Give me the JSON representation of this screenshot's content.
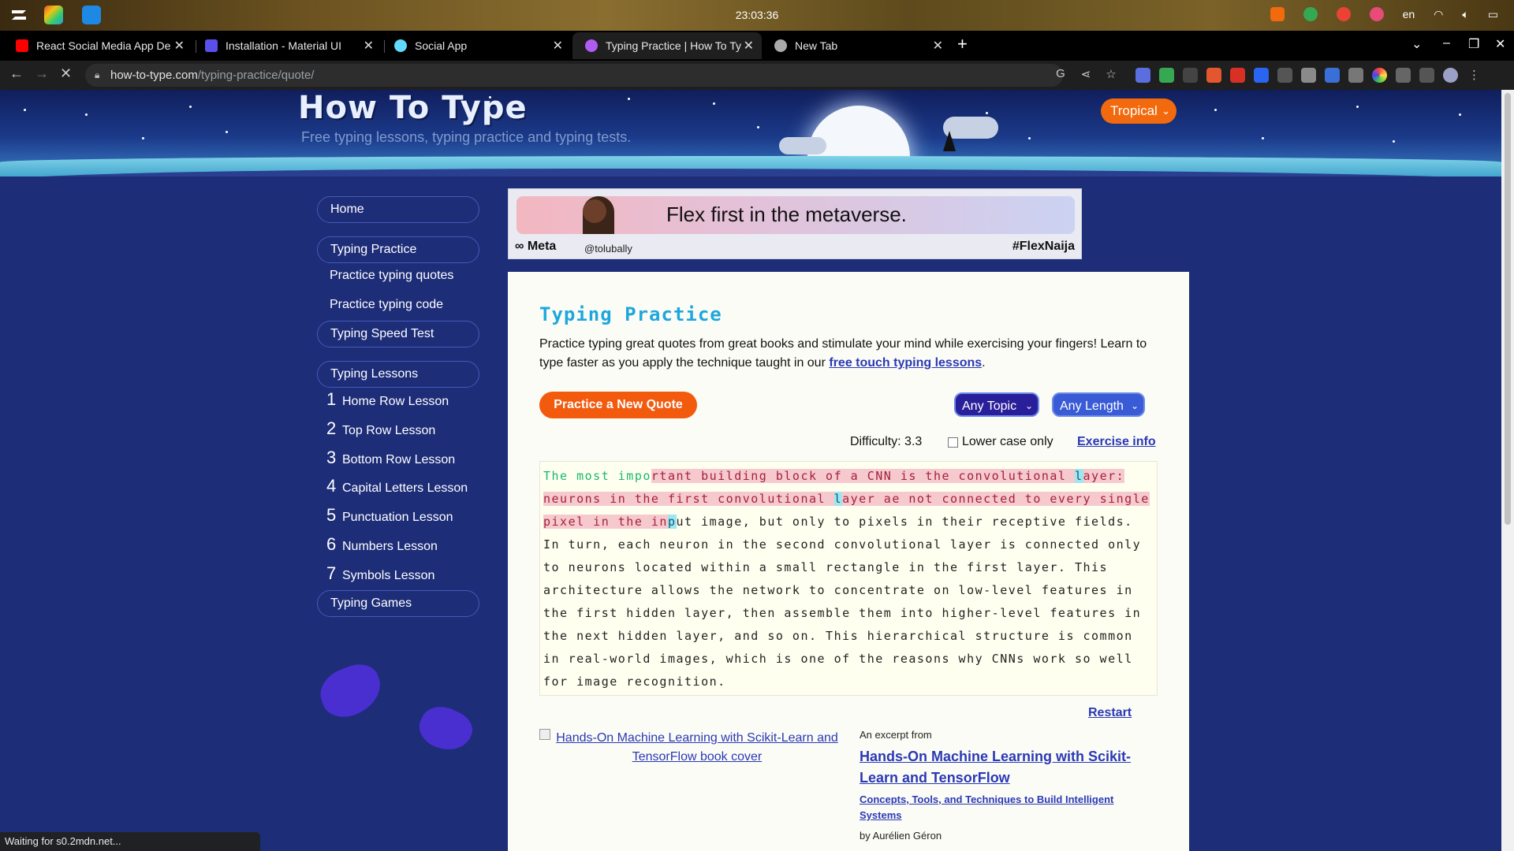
{
  "os": {
    "clock": "23:03:36",
    "lang": "en",
    "icons": [
      "zorin-logo-icon",
      "apps-grid-icon",
      "finder-icon"
    ]
  },
  "browser": {
    "tabs": [
      {
        "title": "React Social Media App Des",
        "favicon": "youtube-icon",
        "color": "#ff0000"
      },
      {
        "title": "Installation - Material UI",
        "favicon": "mui-icon",
        "color": "#5a4fe8"
      },
      {
        "title": "Social App",
        "favicon": "react-icon",
        "color": "#61dafb"
      },
      {
        "title": "Typing Practice | How To Ty",
        "favicon": "howtotype-icon",
        "color": "#b15cf0"
      },
      {
        "title": "New Tab",
        "favicon": "chrome-icon",
        "color": "#aaaaaa"
      }
    ],
    "url_host": "how-to-type.com",
    "url_path": "/typing-practice/quote/",
    "status_text": "Waiting for s0.2mdn.net..."
  },
  "site": {
    "title": "How To Type",
    "tagline": "Free typing lessons, typing practice and typing tests.",
    "theme": "Tropical"
  },
  "sidebar": {
    "home": "Home",
    "typing_practice": "Typing Practice",
    "practice_quotes": "Practice typing quotes",
    "practice_code": "Practice typing code",
    "speed_test": "Typing Speed Test",
    "lessons_header": "Typing Lessons",
    "lessons": [
      {
        "num": "1",
        "label": "Home Row Lesson"
      },
      {
        "num": "2",
        "label": "Top Row Lesson"
      },
      {
        "num": "3",
        "label": "Bottom Row Lesson"
      },
      {
        "num": "4",
        "label": "Capital Letters Lesson"
      },
      {
        "num": "5",
        "label": "Punctuation Lesson"
      },
      {
        "num": "6",
        "label": "Numbers Lesson"
      },
      {
        "num": "7",
        "label": "Symbols Lesson"
      }
    ],
    "games": "Typing Games"
  },
  "ad": {
    "headline": "Flex first in the metaverse.",
    "brand": "∞ Meta",
    "handle": "@tolubally",
    "hashtag": "#FlexNaija"
  },
  "main": {
    "heading": "Typing Practice",
    "intro_text": "Practice typing great quotes from great books and stimulate your mind while exercising your fingers! Learn to type faster as you apply the technique taught in our ",
    "intro_link": "free touch typing lessons",
    "intro_end": ".",
    "new_quote_button": "Practice a New Quote",
    "topic_select": "Any Topic",
    "length_select": "Any Length",
    "difficulty": "Difficulty: 3.3",
    "lowercase_label": "Lower case only",
    "exercise_info": "Exercise info",
    "quote": {
      "correct": "The most impo",
      "wrong_1": "rtant building block of a CNN is the convolutional ",
      "mixed_a": "l",
      "wrong_2": "ayer: neurons in the fir",
      "wrong_3": "st convolutional ",
      "wrong_4": "ayer a",
      "wrong_5": "e not connected to every single pixel in the in",
      "cursor": "p",
      "remaining": "ut image, but only to pixels in their receptive fields. In turn, each neuron in the second convolutional layer is connected only to neurons located within a small rectangle in the first layer. This architecture allows the network to concentrate on low-level features in the first hidden layer, then assemble them into higher-level features in the next hidden layer, and so on. This hierarchical structure is common in real-world images, which is one of the reasons why CNNs work so well for image recognition."
    },
    "restart": "Restart",
    "book": {
      "cover_alt": "Hands-On Machine Learning with Scikit-Learn and TensorFlow book cover",
      "excerpt_from": "An excerpt from",
      "title": "Hands-On Machine Learning with Scikit-Learn and TensorFlow",
      "subtitle": "Concepts, Tools, and Techniques to Build Intelligent Systems",
      "author": "by Aurélien Géron"
    }
  }
}
